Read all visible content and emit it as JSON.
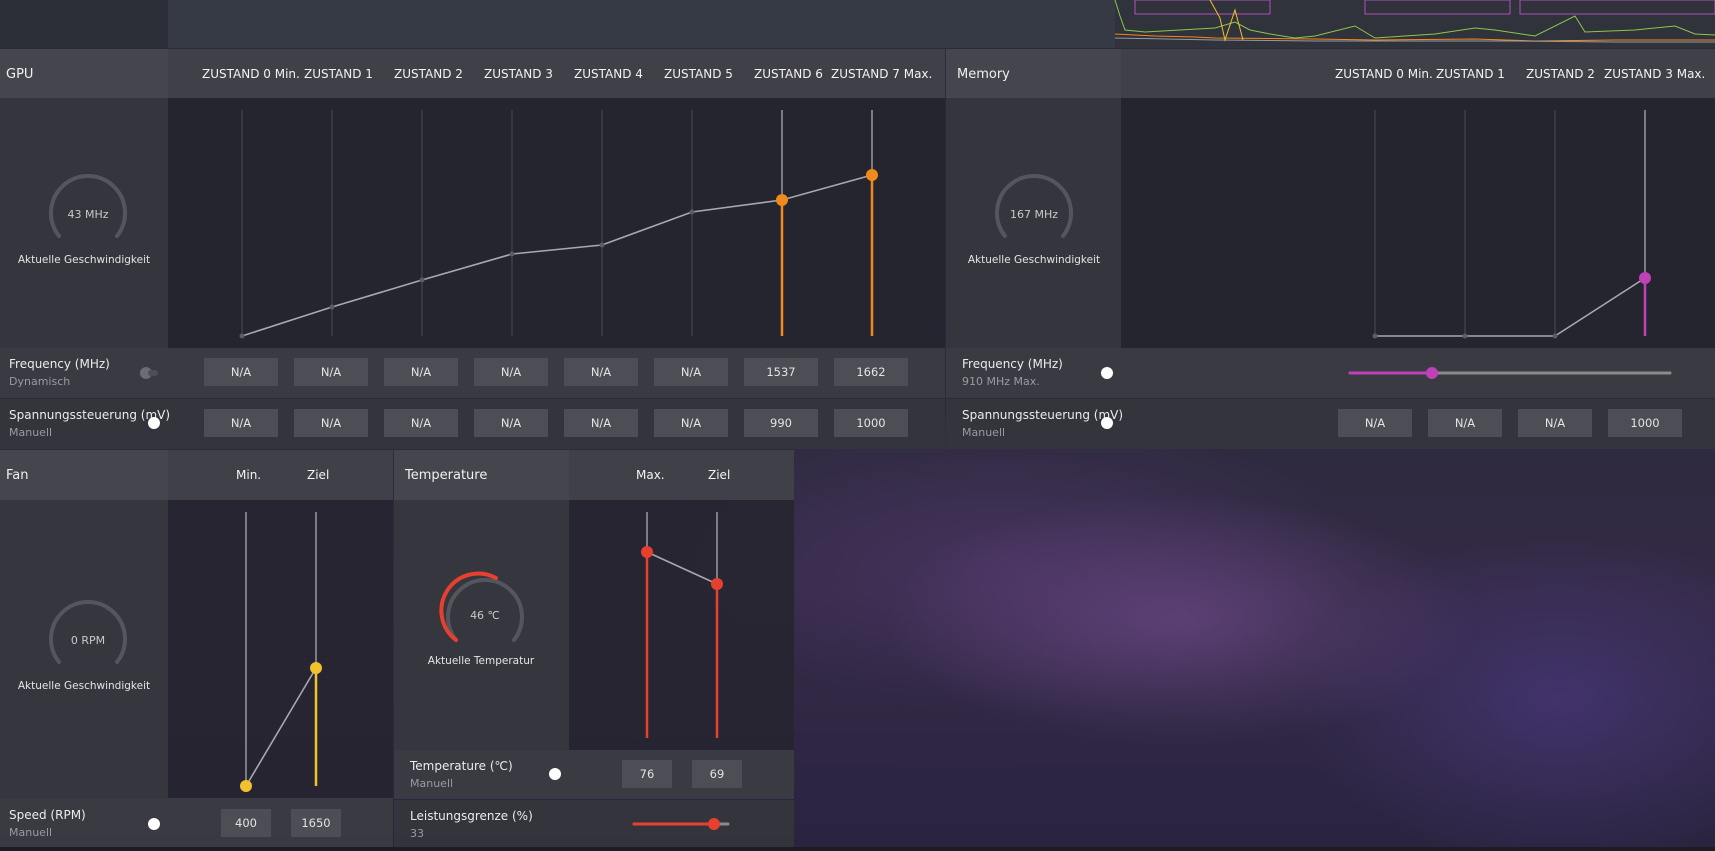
{
  "gpu": {
    "title": "GPU",
    "states": [
      "ZUSTAND 0 Min.",
      "ZUSTAND 1",
      "ZUSTAND 2",
      "ZUSTAND 3",
      "ZUSTAND 4",
      "ZUSTAND 5",
      "ZUSTAND 6",
      "ZUSTAND 7 Max."
    ],
    "gauge_value": "43 MHz",
    "gauge_label": "Aktuelle Geschwindigkeit",
    "frequency": {
      "label": "Frequency (MHz)",
      "mode": "Dynamisch",
      "values": [
        "N/A",
        "N/A",
        "N/A",
        "N/A",
        "N/A",
        "N/A",
        "1537",
        "1662"
      ]
    },
    "voltage": {
      "label": "Spannungssteuerung (mV)",
      "mode": "Manuell",
      "values": [
        "N/A",
        "N/A",
        "N/A",
        "N/A",
        "N/A",
        "N/A",
        "990",
        "1000"
      ]
    },
    "accent": "#f08a1c"
  },
  "memory": {
    "title": "Memory",
    "states": [
      "ZUSTAND 0 Min.",
      "ZUSTAND 1",
      "ZUSTAND 2",
      "ZUSTAND 3 Max."
    ],
    "gauge_value": "167 MHz",
    "gauge_label": "Aktuelle Geschwindigkeit",
    "frequency": {
      "label": "Frequency (MHz)",
      "mode": "910 MHz Max."
    },
    "voltage": {
      "label": "Spannungssteuerung (mV)",
      "mode": "Manuell",
      "values": [
        "N/A",
        "N/A",
        "N/A",
        "1000"
      ]
    },
    "accent": "#c040b8"
  },
  "fan": {
    "title": "Fan",
    "columns": [
      "Min.",
      "Ziel"
    ],
    "gauge_value": "0 RPM",
    "gauge_label": "Aktuelle Geschwindigkeit",
    "speed": {
      "label": "Speed (RPM)",
      "mode": "Manuell",
      "values": [
        "400",
        "1650"
      ]
    },
    "accent": "#f2c12e"
  },
  "temperature": {
    "title": "Temperature",
    "columns": [
      "Max.",
      "Ziel"
    ],
    "gauge_value": "46 ℃",
    "gauge_label": "Aktuelle Temperatur",
    "temp": {
      "label": "Temperature (℃)",
      "mode": "Manuell",
      "values": [
        "76",
        "69"
      ]
    },
    "power": {
      "label": "Leistungsgrenze (%)",
      "value": "33"
    },
    "accent": "#e8402e"
  }
}
